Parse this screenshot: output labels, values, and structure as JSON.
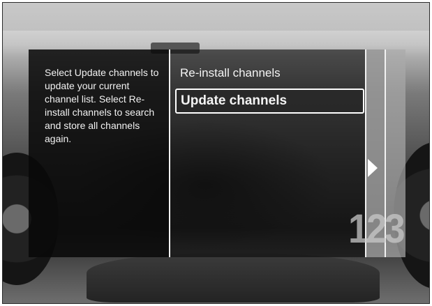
{
  "help": {
    "text": "Select Update channels to update your current channel list. Select Re-install channels to search and store all channels again."
  },
  "menu": {
    "items": [
      {
        "label": "Re-install channels",
        "selected": false
      },
      {
        "label": "Update channels",
        "selected": true
      }
    ]
  },
  "indicator": {
    "page_number": "123",
    "arrow_icon": "right-arrow-icon"
  },
  "colors": {
    "overlay": "#080808",
    "divider": "#f2f2f2",
    "text": "#f4f4f4"
  }
}
